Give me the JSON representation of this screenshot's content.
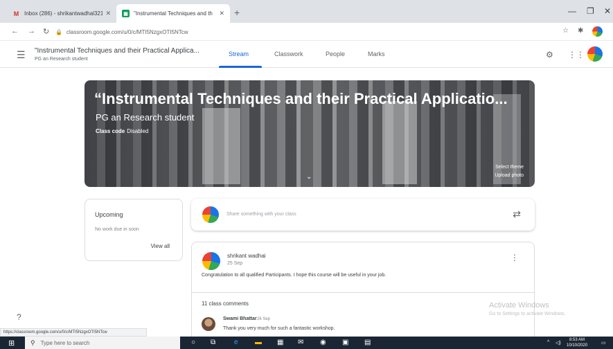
{
  "browser": {
    "tabs": [
      {
        "title": "Inbox (286) - shrikantwadhal321",
        "icon": "gmail-icon"
      },
      {
        "title": "\"Instrumental Techniques and th",
        "icon": "classroom-icon"
      }
    ],
    "url": "classroom.google.com/u/0/c/MTI5NzgxOTI5NTcw"
  },
  "classroom": {
    "class_name": "\"Instrumental Techniques and their Practical Applica...",
    "section": "PG an Research student",
    "tabs": [
      "Stream",
      "Classwork",
      "People",
      "Marks"
    ],
    "active_tab": "Stream"
  },
  "banner": {
    "title": "“Instrumental Techniques and their Practical Applicatio...",
    "subtitle": "PG an Research student",
    "class_code_label": "Class code",
    "class_code_value": "Disabled",
    "select_theme": "Select theme",
    "upload_photo": "Upload photo"
  },
  "upcoming": {
    "title": "Upcoming",
    "empty": "No work due in soon",
    "view_all": "View all"
  },
  "share": {
    "placeholder": "Share something with your class"
  },
  "post": {
    "author": "shrikant wadhai",
    "date": "25 Sep",
    "text": "Congratulation to all qualified Participants. I hope this course will be useful in your job.",
    "comment_count": "11 class comments",
    "comment": {
      "author": "Swami Bhattar",
      "date": "26 Sep",
      "text": "Thank you very much for such a fantastic workshop."
    }
  },
  "status_url": "https://classroom.google.com/u/0/c/MTI5NzgxOTI5NTcw",
  "watermark": {
    "line1": "Activate Windows",
    "line2": "Go to Settings to activate Windows."
  },
  "taskbar": {
    "search_placeholder": "Type here to search",
    "time": "8:53 AM",
    "date": "10/10/2020"
  }
}
